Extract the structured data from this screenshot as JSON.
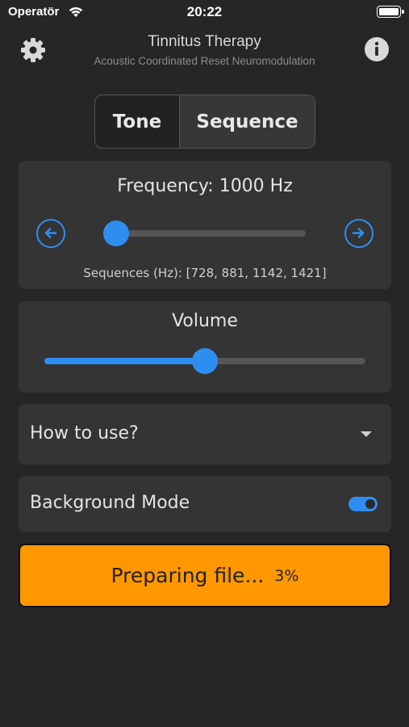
{
  "status_bar": {
    "carrier": "Operatör",
    "time": "20:22"
  },
  "header": {
    "title": "Tinnitus Therapy",
    "subtitle": "Acoustic Coordinated Reset Neuromodulation"
  },
  "mode_tabs": [
    {
      "label": "Tone",
      "selected": false
    },
    {
      "label": "Sequence",
      "selected": true
    }
  ],
  "frequency": {
    "label": "Frequency: 1000 Hz",
    "sequences_text": "Sequences (Hz): [728, 881, 1142, 1421]",
    "slider_fraction": 0.0
  },
  "volume": {
    "label": "Volume",
    "level_fraction": 0.5
  },
  "how_to_use": {
    "label": "How to use?"
  },
  "background_mode": {
    "label": "Background Mode",
    "enabled": true
  },
  "prepare": {
    "label": "Preparing file...",
    "percent": "3%"
  },
  "colors": {
    "accent": "#2e8ef0",
    "button": "#ff9800",
    "background": "#262626",
    "card": "#343434"
  },
  "icons": [
    "wifi-icon",
    "battery-icon",
    "gear-icon",
    "info-icon",
    "arrow-left-icon",
    "arrow-right-icon",
    "chevron-down-icon"
  ]
}
